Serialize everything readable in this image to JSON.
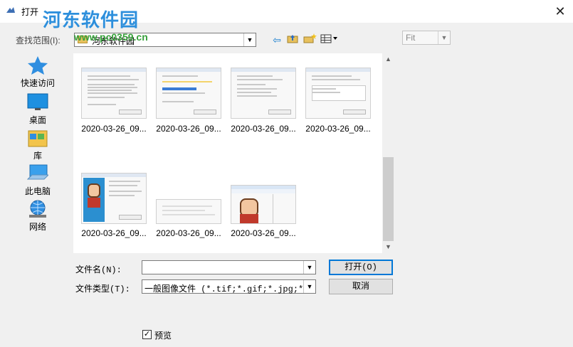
{
  "window": {
    "title": "打开",
    "close_glyph": "✕",
    "watermark": "河东软件园",
    "watermark_url": "www.pc0359.cn"
  },
  "lookin": {
    "label": "查找范围(I):",
    "value": "河东软件园"
  },
  "toolbar": {
    "back_glyph": "⇦",
    "up_glyph": "⤒",
    "newfolder_glyph": "✱",
    "views_glyph": "▦▾"
  },
  "zoom": {
    "value": "Fit"
  },
  "places": [
    {
      "label": "快速访问",
      "icon": "star-icon"
    },
    {
      "label": "桌面",
      "icon": "desktop-icon"
    },
    {
      "label": "库",
      "icon": "library-icon"
    },
    {
      "label": "此电脑",
      "icon": "computer-icon"
    },
    {
      "label": "网络",
      "icon": "network-icon"
    }
  ],
  "files": [
    {
      "name": "2020-03-26_09..."
    },
    {
      "name": "2020-03-26_09..."
    },
    {
      "name": "2020-03-26_09..."
    },
    {
      "name": "2020-03-26_09..."
    },
    {
      "name": "2020-03-26_09..."
    },
    {
      "name": "2020-03-26_09..."
    },
    {
      "name": "2020-03-26_09..."
    }
  ],
  "form": {
    "filename_label": "文件名(N):",
    "filename_value": "",
    "filetype_label": "文件类型(T):",
    "filetype_value": "一般图像文件 (*.tif;*.gif;*.jpg;*.pcx",
    "open_label": "打开(O)",
    "cancel_label": "取消",
    "preview_label": "预览",
    "preview_checked": "✓"
  },
  "colors": {
    "accent": "#0078d7",
    "watermark": "#2d8fdc",
    "watermark_url": "#37a13b"
  }
}
